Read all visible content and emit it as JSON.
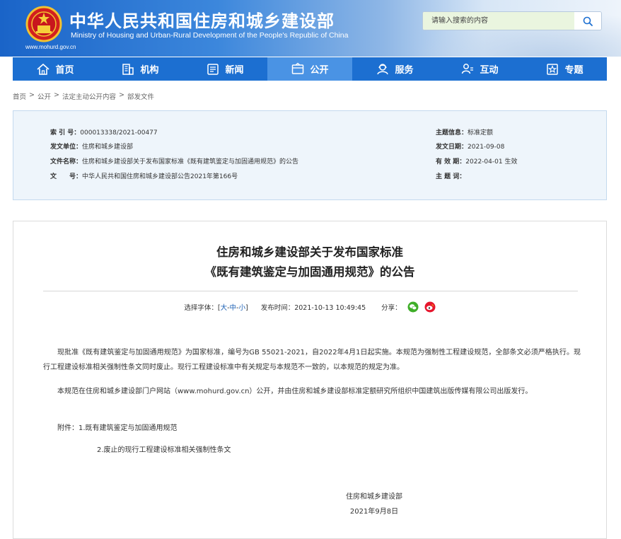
{
  "header": {
    "title": "中华人民共和国住房和城乡建设部",
    "subtitle": "Ministry of Housing and Urban-Rural Development of the People's Republic of China",
    "domain": "www.mohurd.gov.cn",
    "search_placeholder": "请输入搜索的内容",
    "search_icon": "search-icon",
    "emblem": "national-emblem"
  },
  "colors": {
    "header_blue": "#1a64c8",
    "nav_blue": "#1c6fd1",
    "nav_active": "#4a93e4",
    "info_bg": "#eef5fb",
    "link_blue": "#1a5fb4"
  },
  "nav": {
    "items": [
      {
        "label": "首页",
        "icon": "home-icon"
      },
      {
        "label": "机构",
        "icon": "building-icon"
      },
      {
        "label": "新闻",
        "icon": "news-icon"
      },
      {
        "label": "公开",
        "icon": "disclosure-icon",
        "active": true
      },
      {
        "label": "服务",
        "icon": "service-icon"
      },
      {
        "label": "互动",
        "icon": "interact-icon"
      },
      {
        "label": "专题",
        "icon": "topic-icon"
      }
    ]
  },
  "breadcrumb": {
    "items": [
      "首页",
      "公开",
      "法定主动公开内容",
      "部发文件"
    ],
    "separator": ">"
  },
  "info": {
    "index_label": "索 引 号：",
    "index_value": "000013338/2021-00477",
    "issuer_label": "发文单位：",
    "issuer_value": "住房和城乡建设部",
    "docname_label": "文件名称：",
    "docname_value": "住房和城乡建设部关于发布国家标准《既有建筑鉴定与加固通用规范》的公告",
    "docno_label": "文　　号：",
    "docno_value": "中华人民共和国住房和城乡建设部公告2021年第166号",
    "topic_label": "主题信息：",
    "topic_value": "标准定额",
    "date_label": "发文日期：",
    "date_value": "2021-09-08",
    "valid_label": "有 效 期：",
    "valid_value": "2022-04-01 生效",
    "keywords_label": "主 题 词：",
    "keywords_value": ""
  },
  "article": {
    "title_line1": "住房和城乡建设部关于发布国家标准",
    "title_line2": "《既有建筑鉴定与加固通用规范》的公告",
    "font_label": "选择字体：[",
    "font_large": "大",
    "font_medium": "中",
    "font_small": "小",
    "font_sep": "-",
    "font_end": "]",
    "publish_label": "发布时间：",
    "publish_time": "2021-10-13 10:49:45",
    "share_label": "分享：",
    "share_icons": [
      "wechat-icon",
      "weibo-icon"
    ],
    "p1": "现批准《既有建筑鉴定与加固通用规范》为国家标准，编号为GB 55021-2021，自2022年4月1日起实施。本规范为强制性工程建设规范，全部条文必须严格执行。现行工程建设标准相关强制性条文同时废止。现行工程建设标准中有关规定与本规范不一致的，以本规范的规定为准。",
    "p2": "本规范在住房和城乡建设部门户网站（www.mohurd.gov.cn）公开，并由住房和城乡建设部标准定额研究所组织中国建筑出版传媒有限公司出版发行。",
    "attach1": "附件：1.既有建筑鉴定与加固通用规范",
    "attach2": "2.废止的现行工程建设标准相关强制性条文",
    "signature": "住房和城乡建设部",
    "sign_date": "2021年9月8日"
  }
}
